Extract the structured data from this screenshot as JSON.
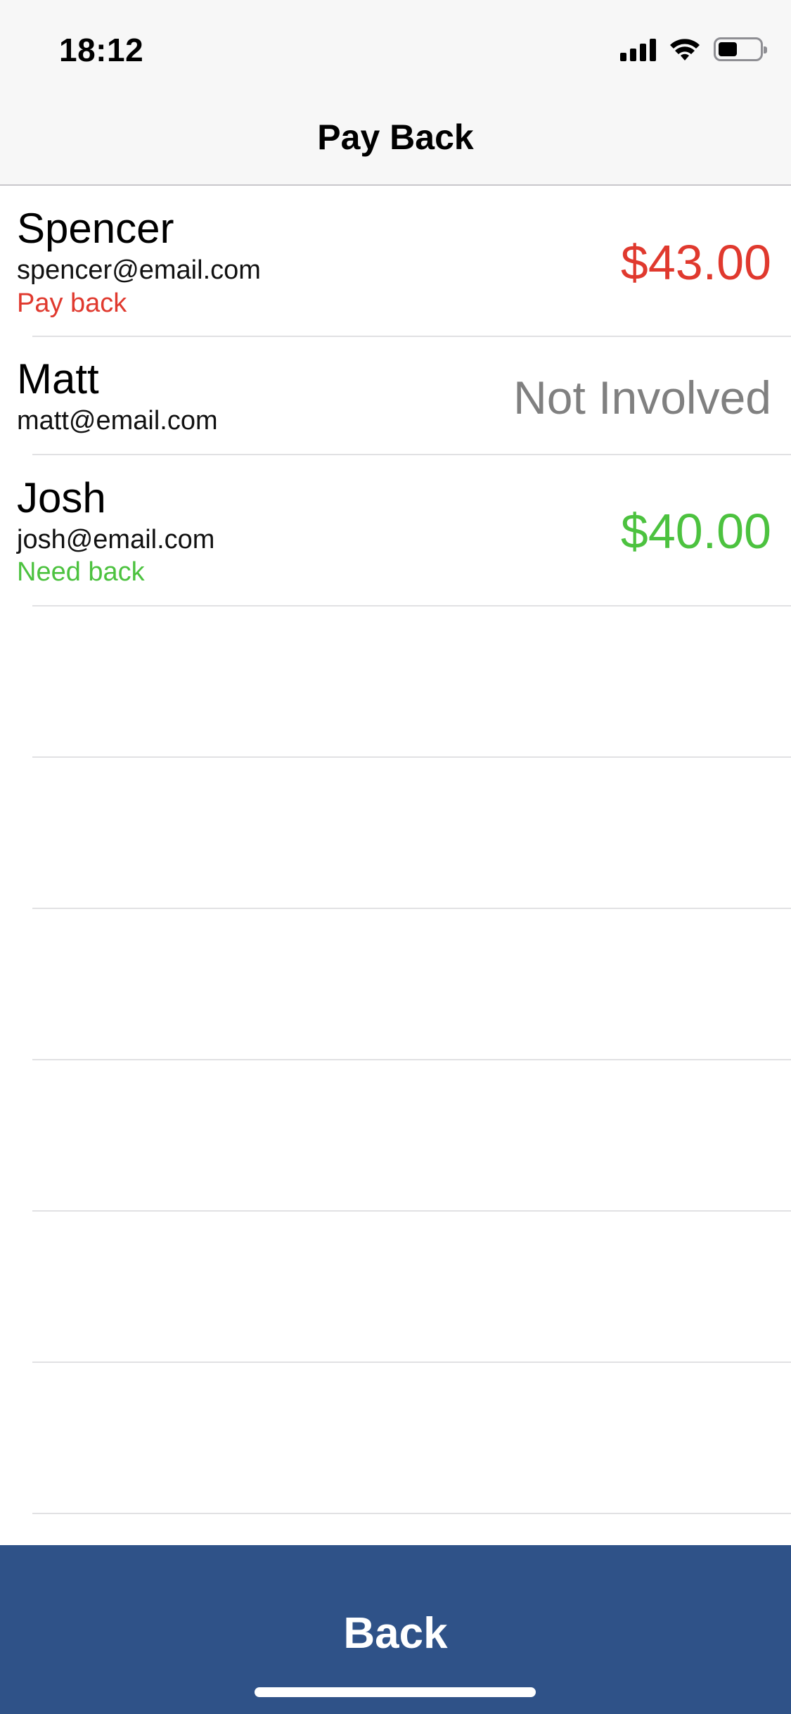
{
  "status_bar": {
    "time": "18:12",
    "icons": [
      "signal-icon",
      "wifi-icon",
      "battery-icon"
    ]
  },
  "nav": {
    "title": "Pay Back"
  },
  "people": [
    {
      "name": "Spencer",
      "email": "spencer@email.com",
      "status": "Pay back",
      "amount": "$43.00",
      "color": "#e0392e"
    },
    {
      "name": "Matt",
      "email": "matt@email.com",
      "status": "",
      "amount": "Not Involved",
      "color": "#808080"
    },
    {
      "name": "Josh",
      "email": "josh@email.com",
      "status": "Need back",
      "amount": "$40.00",
      "color": "#4cc23f"
    }
  ],
  "footer": {
    "back_label": "Back",
    "background": "#2f5288"
  }
}
